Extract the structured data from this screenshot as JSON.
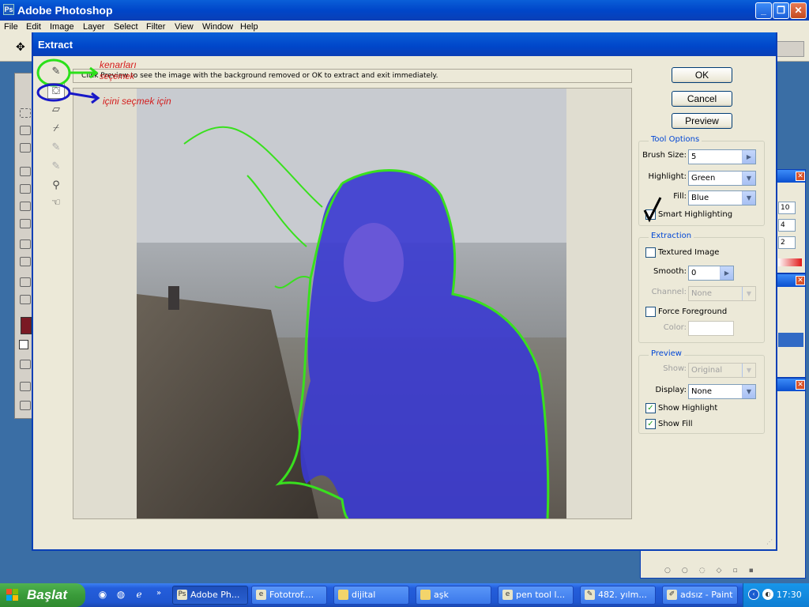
{
  "app": {
    "title": "Adobe Photoshop"
  },
  "menu": [
    "File",
    "Edit",
    "Image",
    "Layer",
    "Select",
    "Filter",
    "View",
    "Window",
    "Help"
  ],
  "dialog": {
    "title": "Extract",
    "hint": "Click Preview to see the image with the background removed or OK to extract and exit immediately.",
    "buttons": {
      "ok": "OK",
      "cancel": "Cancel",
      "preview": "Preview"
    },
    "tool_options": {
      "legend": "Tool Options",
      "brush_size_label": "Brush Size:",
      "brush_size": "5",
      "highlight_label": "Highlight:",
      "highlight": "Green",
      "fill_label": "Fill:",
      "fill": "Blue",
      "smart_highlighting": "Smart Highlighting"
    },
    "extraction": {
      "legend": "Extraction",
      "textured_image": "Textured Image",
      "smooth_label": "Smooth:",
      "smooth": "0",
      "channel_label": "Channel:",
      "channel": "None",
      "force_foreground": "Force Foreground",
      "color_label": "Color:"
    },
    "preview_group": {
      "legend": "Preview",
      "show_label": "Show:",
      "show": "Original",
      "display_label": "Display:",
      "display": "None",
      "show_highlight": "Show Highlight",
      "show_fill": "Show Fill"
    }
  },
  "annotations": {
    "edge": "kenarları",
    "edge2": "seçemek",
    "inside": "içini seçmek için"
  },
  "right_panel": {
    "v1": "10",
    "v2": "4",
    "v3": "2"
  },
  "taskbar": {
    "start": "Başlat",
    "tasks": [
      "Adobe Ph...",
      "Fototrof....",
      "dijital",
      "aşk",
      "pen tool l...",
      "482. yılm...",
      "adsız - Paint"
    ],
    "clock": "17:30"
  },
  "colors": {
    "highlight": "#39e01e",
    "fill": "#3a3ad0",
    "xp_blue": "#0a3fb6"
  }
}
